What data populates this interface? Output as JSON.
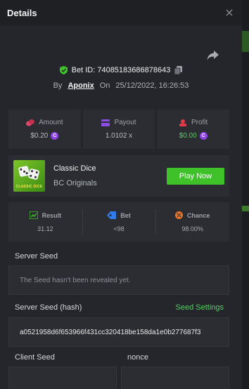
{
  "modal": {
    "title": "Details"
  },
  "bet": {
    "id_label": "Bet ID: 74085183686878643",
    "by_label": "By",
    "user": "Aponix",
    "on_label": "On",
    "datetime": "25/12/2022, 16:26:53"
  },
  "stats": {
    "amount": {
      "label": "Amount",
      "value": "$0.20",
      "icon": "coins-icon"
    },
    "payout": {
      "label": "Payout",
      "value": "1.0102 x",
      "icon": "wallet-icon"
    },
    "profit": {
      "label": "Profit",
      "value": "$0.00",
      "icon": "profit-icon"
    }
  },
  "game": {
    "name": "Classic Dice",
    "provider": "BC Originals",
    "thumb_text": "CLASSIC DICE",
    "play_label": "Play Now"
  },
  "results": {
    "result": {
      "label": "Result",
      "value": "31.12",
      "icon": "result-chart-icon"
    },
    "bet": {
      "label": "Bet",
      "value": "<98",
      "icon": "bet-tag-icon"
    },
    "chance": {
      "label": "Chance",
      "value": "98.00%",
      "icon": "chance-icon"
    }
  },
  "server_seed": {
    "label": "Server Seed",
    "value": "The Seed hasn't been revealed yet."
  },
  "server_seed_hash": {
    "label": "Server Seed (hash)",
    "settings_link": "Seed Settings",
    "value": "a0521958d6f653966f431cc320418be158da1e0b277687f3"
  },
  "client_seed": {
    "label": "Client Seed"
  },
  "nonce": {
    "label": "nonce"
  },
  "colors": {
    "accent_green": "#3fc12a",
    "profit_green": "#4fd35a",
    "coin_purple": "#8e43e6"
  }
}
